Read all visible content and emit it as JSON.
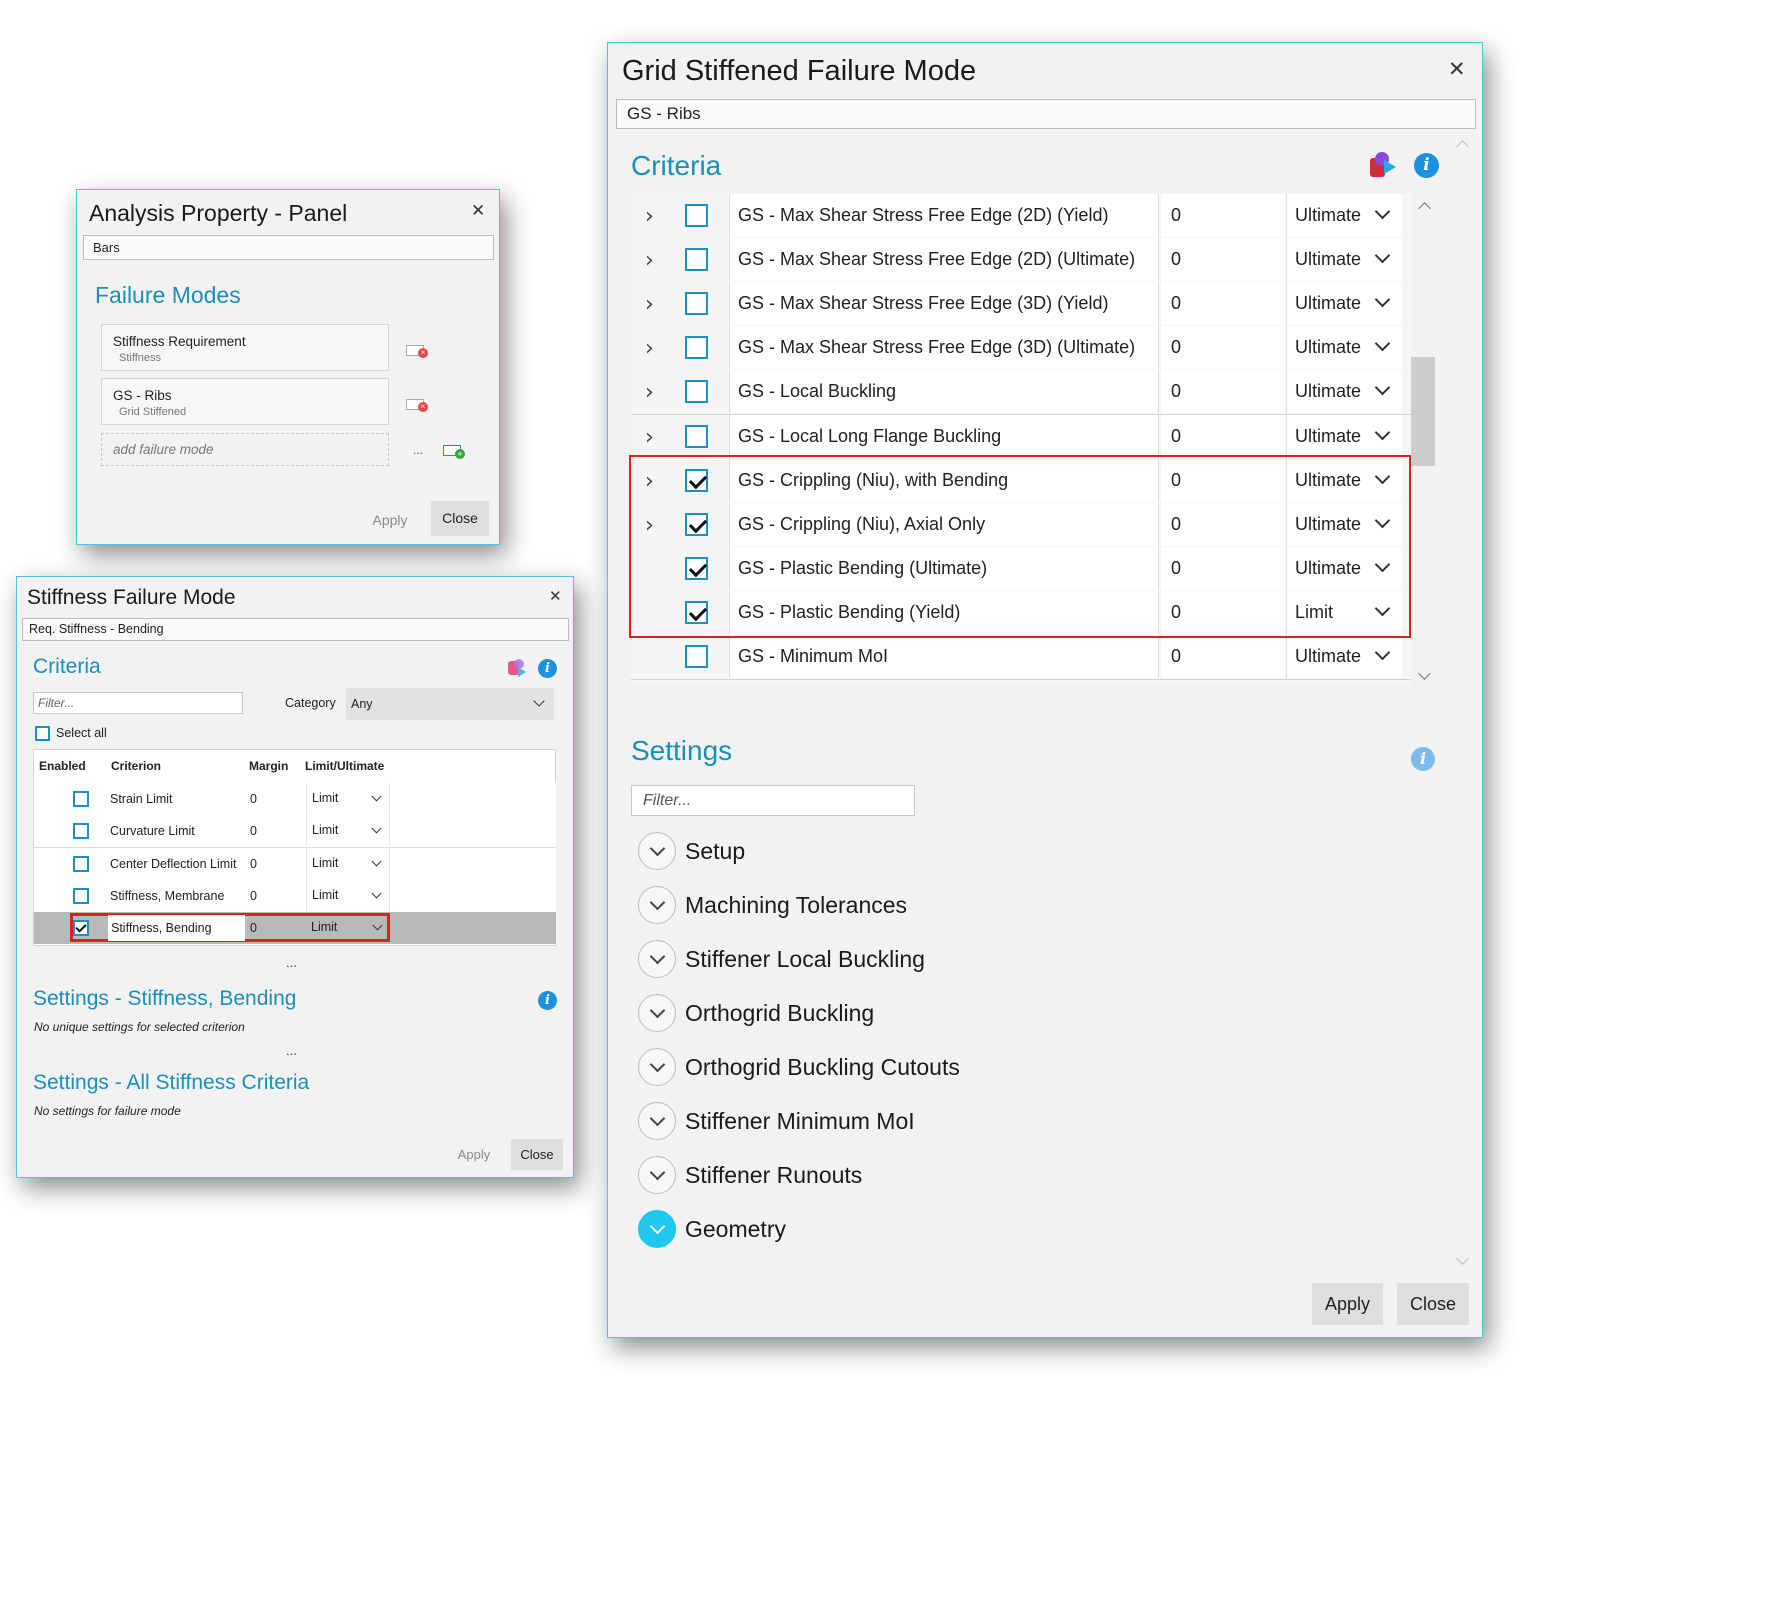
{
  "analysis_panel": {
    "title": "Analysis Property - Panel",
    "close_glyph": "✕",
    "selector_value": "Bars",
    "section_title": "Failure Modes",
    "failure_modes": [
      {
        "name": "Stiffness Requirement",
        "type": "Stiffness"
      },
      {
        "name": "GS - Ribs",
        "type": "Grid Stiffened"
      }
    ],
    "add_placeholder": "add failure mode",
    "add_ellipsis": "...",
    "apply_label": "Apply",
    "close_label": "Close"
  },
  "stiffness_dialog": {
    "title": "Stiffness Failure Mode",
    "close_glyph": "✕",
    "name_value": "Req. Stiffness - Bending",
    "criteria_title": "Criteria",
    "filter_placeholder": "Filter...",
    "category_label": "Category",
    "category_value": "Any",
    "select_all_label": "Select all",
    "columns": {
      "enabled": "Enabled",
      "criterion": "Criterion",
      "margin": "Margin",
      "limit": "Limit/Ultimate"
    },
    "rows": [
      {
        "criterion": "Strain Limit",
        "margin": "0",
        "limit": "Limit",
        "enabled": false
      },
      {
        "criterion": "Curvature Limit",
        "margin": "0",
        "limit": "Limit",
        "enabled": false
      },
      {
        "criterion": "Center Deflection Limit",
        "margin": "0",
        "limit": "Limit",
        "enabled": false
      },
      {
        "criterion": "Stiffness, Membrane",
        "margin": "0",
        "limit": "Limit",
        "enabled": false
      },
      {
        "criterion": "Stiffness, Bending",
        "margin": "0",
        "limit": "Limit",
        "enabled": true
      }
    ],
    "ellipsis": "...",
    "settings_title": "Settings - Stiffness, Bending",
    "settings_note": "No unique settings for selected criterion",
    "all_settings_title": "Settings - All Stiffness Criteria",
    "all_settings_note": "No settings for failure mode",
    "apply_label": "Apply",
    "close_label": "Close"
  },
  "grid_dialog": {
    "title": "Grid Stiffened Failure Mode",
    "close_glyph": "✕",
    "name_value": "GS - Ribs",
    "criteria_title": "Criteria",
    "rows": [
      {
        "criterion": "GS - Max Shear Stress Free Edge (2D) (Yield)",
        "margin": "0",
        "limit": "Ultimate",
        "enabled": false,
        "expandable": true
      },
      {
        "criterion": "GS - Max Shear Stress Free Edge (2D) (Ultimate)",
        "margin": "0",
        "limit": "Ultimate",
        "enabled": false,
        "expandable": true
      },
      {
        "criterion": "GS - Max Shear Stress Free Edge (3D) (Yield)",
        "margin": "0",
        "limit": "Ultimate",
        "enabled": false,
        "expandable": true
      },
      {
        "criterion": "GS - Max Shear Stress Free Edge (3D) (Ultimate)",
        "margin": "0",
        "limit": "Ultimate",
        "enabled": false,
        "expandable": true
      },
      {
        "criterion": "GS - Local Buckling",
        "margin": "0",
        "limit": "Ultimate",
        "enabled": false,
        "expandable": true
      },
      {
        "criterion": "GS - Local Long Flange Buckling",
        "margin": "0",
        "limit": "Ultimate",
        "enabled": false,
        "expandable": true
      },
      {
        "criterion": "GS - Crippling (Niu), with Bending",
        "margin": "0",
        "limit": "Ultimate",
        "enabled": true,
        "expandable": true
      },
      {
        "criterion": "GS - Crippling (Niu), Axial Only",
        "margin": "0",
        "limit": "Ultimate",
        "enabled": true,
        "expandable": true
      },
      {
        "criterion": "GS - Plastic Bending (Ultimate)",
        "margin": "0",
        "limit": "Ultimate",
        "enabled": true,
        "expandable": false
      },
      {
        "criterion": "GS - Plastic Bending (Yield)",
        "margin": "0",
        "limit": "Limit",
        "enabled": true,
        "expandable": false
      },
      {
        "criterion": "GS - Minimum MoI",
        "margin": "0",
        "limit": "Ultimate",
        "enabled": false,
        "expandable": false
      }
    ],
    "settings_title": "Settings",
    "filter_placeholder": "Filter...",
    "settings_groups": [
      {
        "label": "Setup",
        "active": false
      },
      {
        "label": "Machining Tolerances",
        "active": false
      },
      {
        "label": "Stiffener Local Buckling",
        "active": false
      },
      {
        "label": "Orthogrid Buckling",
        "active": false
      },
      {
        "label": "Orthogrid Buckling Cutouts",
        "active": false
      },
      {
        "label": "Stiffener Minimum MoI",
        "active": false
      },
      {
        "label": "Stiffener Runouts",
        "active": false
      },
      {
        "label": "Geometry",
        "active": true
      }
    ],
    "apply_label": "Apply",
    "close_label": "Close"
  },
  "colors": {
    "accent": "#1a8fb8",
    "highlight_red": "#e02020",
    "info_blue": "#1e90e0",
    "active_cyan": "#1ec8ef"
  }
}
